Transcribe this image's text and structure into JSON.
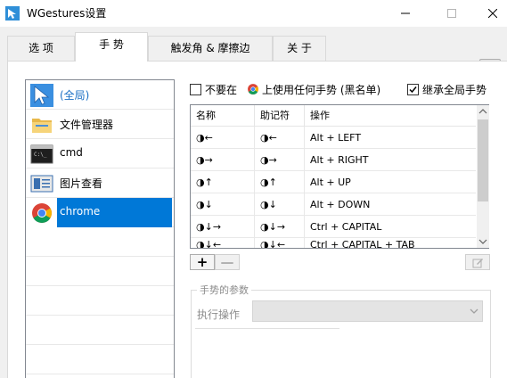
{
  "window": {
    "title": "WGestures设置"
  },
  "tabs": [
    {
      "label": "选 项"
    },
    {
      "label": "手 势"
    },
    {
      "label": "触发角 & 摩擦边"
    },
    {
      "label": "关 于"
    }
  ],
  "apps": [
    {
      "label": "(全局)",
      "icon": "cursor-icon"
    },
    {
      "label": "文件管理器",
      "icon": "folder-icon"
    },
    {
      "label": "cmd",
      "icon": "terminal-icon"
    },
    {
      "label": "图片查看",
      "icon": "image-viewer-icon"
    },
    {
      "label": "chrome",
      "icon": "chrome-icon"
    }
  ],
  "options": {
    "disable_prefix": "不要在",
    "disable_suffix": "上使用任何手势 (黑名单)",
    "disable_checked": false,
    "inherit_label": "继承全局手势",
    "inherit_checked": true
  },
  "gesture_table": {
    "columns": [
      "名称",
      "助记符",
      "操作"
    ],
    "rows": [
      {
        "name": "◑←",
        "mnemonic": "◑←",
        "action": "Alt + LEFT"
      },
      {
        "name": "◑→",
        "mnemonic": "◑→",
        "action": "Alt + RIGHT"
      },
      {
        "name": "◑↑",
        "mnemonic": "◑↑",
        "action": "Alt + UP"
      },
      {
        "name": "◑↓",
        "mnemonic": "◑↓",
        "action": "Alt + DOWN"
      },
      {
        "name": "◑↓→",
        "mnemonic": "◑↓→",
        "action": "Ctrl + CAPITAL"
      },
      {
        "name": "◑↓←",
        "mnemonic": "◑↓←",
        "action": "Ctrl + CAPITAL + TAB"
      }
    ]
  },
  "buttons": {
    "add": "+",
    "remove": "—"
  },
  "params": {
    "group_title": "手势的参数",
    "exec_label": "执行操作",
    "exec_value": ""
  },
  "colors": {
    "selection": "#0078d7",
    "disabled_text": "#8c8c8c"
  }
}
